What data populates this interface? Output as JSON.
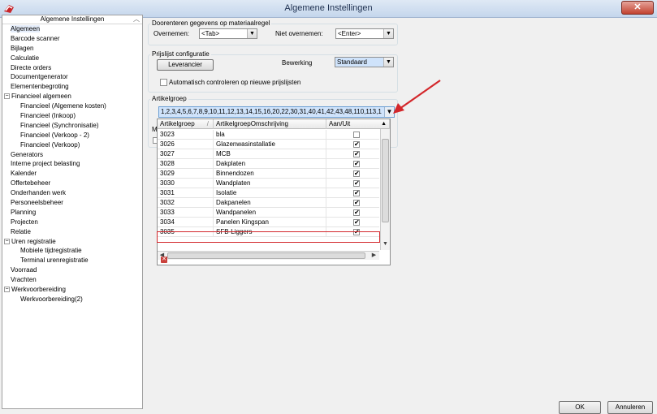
{
  "window": {
    "title": "Algemene Instellingen",
    "close_glyph": "✕",
    "app_icon": "app-logo-icon"
  },
  "tree": {
    "header": "Algemene Instellingen",
    "items": [
      {
        "label": "Algemeen",
        "level": 0,
        "selected": true
      },
      {
        "label": "Barcode scanner",
        "level": 0
      },
      {
        "label": "Bijlagen",
        "level": 0
      },
      {
        "label": "Calculatie",
        "level": 0
      },
      {
        "label": "Directe orders",
        "level": 0
      },
      {
        "label": "Documentgenerator",
        "level": 0
      },
      {
        "label": "Elementenbegroting",
        "level": 0
      },
      {
        "label": "Financieel algemeen",
        "level": 0,
        "expander": "−"
      },
      {
        "label": "Financieel (Algemene kosten)",
        "level": 1
      },
      {
        "label": "Financieel (Inkoop)",
        "level": 1
      },
      {
        "label": "Financieel (Synchronisatie)",
        "level": 1
      },
      {
        "label": "Financieel (Verkoop - 2)",
        "level": 1
      },
      {
        "label": "Financieel (Verkoop)",
        "level": 1
      },
      {
        "label": "Generators",
        "level": 0
      },
      {
        "label": "Interne project belasting",
        "level": 0
      },
      {
        "label": "Kalender",
        "level": 0
      },
      {
        "label": "Offertebeheer",
        "level": 0
      },
      {
        "label": "Onderhanden werk",
        "level": 0
      },
      {
        "label": "Personeelsbeheer",
        "level": 0
      },
      {
        "label": "Planning",
        "level": 0
      },
      {
        "label": "Projecten",
        "level": 0
      },
      {
        "label": "Relatie",
        "level": 0
      },
      {
        "label": "Uren registratie",
        "level": 0,
        "expander": "−"
      },
      {
        "label": "Mobiele tijdregistratie",
        "level": 1
      },
      {
        "label": "Terminal urenregistratie",
        "level": 1
      },
      {
        "label": "Voorraad",
        "level": 0
      },
      {
        "label": "Vrachten",
        "level": 0
      },
      {
        "label": "Werkvoorbereiding",
        "level": 0,
        "expander": "−"
      },
      {
        "label": "Werkvoorbereiding(2)",
        "level": 1
      }
    ]
  },
  "doorenteren": {
    "group_label": "Doorenteren gegevens op materiaalregel",
    "overnemen_label": "Overnemen:",
    "overnemen_value": "<Tab>",
    "niet_overnemen_label": "Niet overnemen:",
    "niet_overnemen_value": "<Enter>"
  },
  "prijslijst": {
    "group_label": "Prijslijst configuratie",
    "leverancier_button": "Leverancier",
    "bewerking_label": "Bewerking",
    "bewerking_value": "Standaard",
    "auto_check_label": "Automatisch controleren op nieuwe prijslijsten",
    "auto_check_checked": false
  },
  "artikelgroep": {
    "group_label": "Artikelgroep",
    "value": "1,2,3,4,5,6,7,8,9,10,11,12,13,14,15,16,20,22,30,31,40,41,42,43,48,110,113,1",
    "columns": [
      "Artikelgroep",
      "ArtikelgroepOmschrijving",
      "Aan/Uit"
    ],
    "sort_glyph": "/",
    "rows": [
      {
        "code": "3023",
        "desc": "bla",
        "on": false
      },
      {
        "code": "3026",
        "desc": "Glazenwasinstallatie",
        "on": true
      },
      {
        "code": "3027",
        "desc": "MCB",
        "on": true
      },
      {
        "code": "3028",
        "desc": "Dakplaten",
        "on": true
      },
      {
        "code": "3029",
        "desc": "Binnendozen",
        "on": true
      },
      {
        "code": "3030",
        "desc": "Wandplaten",
        "on": true
      },
      {
        "code": "3031",
        "desc": "Isolatie",
        "on": true
      },
      {
        "code": "3032",
        "desc": "Dakpanelen",
        "on": true
      },
      {
        "code": "3033",
        "desc": "Wandpanelen",
        "on": true
      },
      {
        "code": "3034",
        "desc": "Panelen Kingspan",
        "on": true
      },
      {
        "code": "3035",
        "desc": "SFB-Liggers",
        "on": true
      }
    ],
    "behind_label": "M"
  },
  "footer": {
    "ok_label": "OK",
    "cancel_label": "Annuleren"
  },
  "colors": {
    "highlight": "#d3272b",
    "arrow": "#d3272b",
    "selection": "#cfe3fb"
  }
}
